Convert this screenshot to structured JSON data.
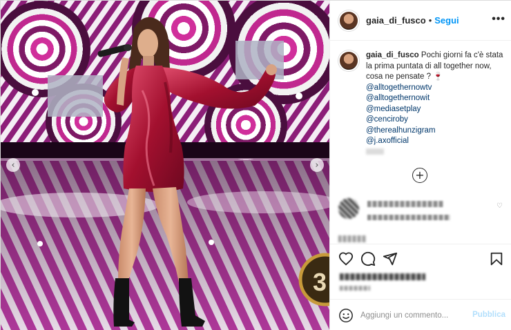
{
  "header": {
    "username": "gaia_di_fusco",
    "separator": "•",
    "follow_label": "Segui",
    "more_icon": "more-horizontal-icon",
    "more_label": "•••"
  },
  "caption": {
    "username": "gaia_di_fusco",
    "text": "Pochi giorni fa c'è stata la prima puntata di all together now, cosa ne pensate ? 🍷",
    "mentions": [
      "@alltogethernowtv",
      "@alltogethernowit",
      "@mediasetplay",
      "@cenciroby",
      "@therealhunzigram",
      "@j.axofficial"
    ]
  },
  "media": {
    "prev_icon": "chevron-left-icon",
    "prev_label": "‹",
    "next_icon": "chevron-right-icon",
    "next_label": "›",
    "badge_number": "3"
  },
  "load_more": {
    "icon": "plus-circle-icon",
    "label": "+"
  },
  "comment": {
    "like_icon": "heart-small-icon",
    "like_label": "♡"
  },
  "actions": {
    "like_icon": "heart-icon",
    "comment_icon": "comment-icon",
    "share_icon": "paper-plane-icon",
    "save_icon": "bookmark-icon"
  },
  "composer": {
    "emoji_icon": "emoji-icon",
    "placeholder": "Aggiungi un commento...",
    "publish_label": "Pubblica"
  },
  "colors": {
    "link_blue": "#0095f6",
    "mention_blue": "#00376b",
    "publish_disabled": "#b2dffc",
    "dress": "#b0143a",
    "stage_magenta": "#c0288f"
  }
}
